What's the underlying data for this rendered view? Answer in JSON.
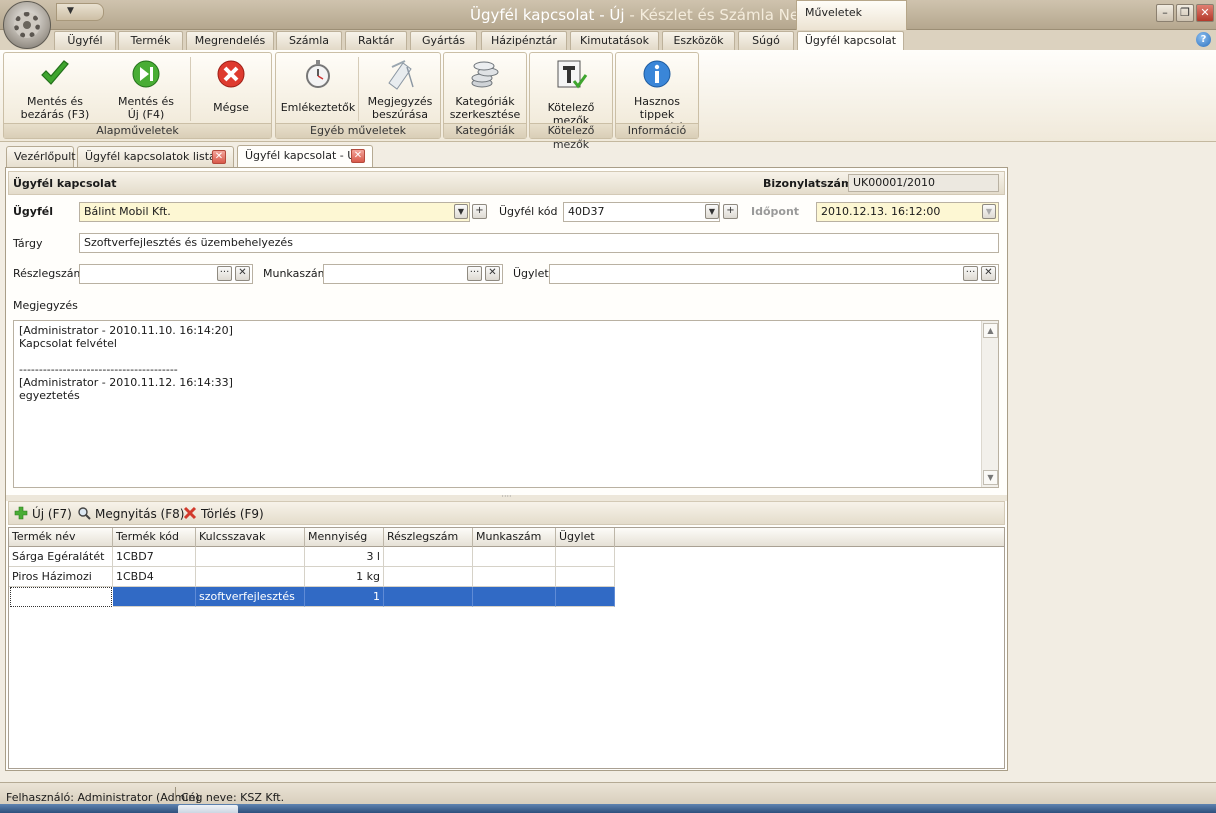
{
  "window": {
    "title": "Ügyfél kapcsolat - Új",
    "title_suffix": " - Készlet és Számla Next Demó",
    "context_tab": "Műveletek"
  },
  "ribbon_tabs": [
    "Ügyfél",
    "Termék",
    "Megrendelés",
    "Számla",
    "Raktár",
    "Gyártás",
    "Házipénztár",
    "Kimutatások",
    "Eszközök",
    "Súgó",
    "Ügyfél kapcsolat"
  ],
  "ribbon_groups": {
    "alap": {
      "label": "Alapműveletek",
      "buttons": [
        {
          "label": "Mentés és\nbezárás (F3)",
          "icon": "checkmark-icon"
        },
        {
          "label": "Mentés és\nÚj (F4)",
          "icon": "save-new-icon"
        },
        {
          "label": "Mégse",
          "icon": "cancel-icon"
        }
      ]
    },
    "egyeb": {
      "label": "Egyéb műveletek",
      "buttons": [
        {
          "label": "Emlékeztetők",
          "icon": "stopwatch-icon"
        },
        {
          "label": "Megjegyzés\nbeszúrása",
          "icon": "note-icon"
        }
      ]
    },
    "kategoriak": {
      "label": "Kategóriák",
      "buttons": [
        {
          "label": "Kategóriák\nszerkesztése",
          "icon": "coins-icon"
        }
      ]
    },
    "kotelezo": {
      "label": "Kötelező mezők",
      "buttons": [
        {
          "label": "Kötelező mezők",
          "icon": "required-fields-icon"
        }
      ]
    },
    "info": {
      "label": "Információ",
      "buttons": [
        {
          "label": "Hasznos tippek\nmegjelenítése",
          "icon": "info-icon"
        }
      ]
    }
  },
  "doc_tabs": [
    "Vezérlőpult",
    "Ügyfél kapcsolatok listája",
    "Ügyfél kapcsolat - Új"
  ],
  "form": {
    "header_title": "Ügyfél kapcsolat",
    "doc_number_label": "Bizonylatszám",
    "doc_number": "UK00001/2010",
    "customer_label": "Ügyfél",
    "customer_value": "Bálint Mobil Kft.",
    "customer_code_label": "Ügyfél kód",
    "customer_code_value": "40D37",
    "time_label": "Időpont",
    "time_value": "2010.12.13. 16:12:00",
    "subject_label": "Tárgy",
    "subject_value": "Szoftverfejlesztés és üzembehelyezés",
    "department_label": "Részlegszám",
    "department_value": "",
    "job_label": "Munkaszám",
    "job_value": "",
    "deal_label": "Ügylet",
    "deal_value": "",
    "note_label": "Megjegyzés",
    "note_lines": [
      "[Administrator - 2010.11.10.  16:14:20]",
      "Kapcsolat felvétel",
      "",
      "----------------------------------------",
      "[Administrator - 2010.11.12.  16:14:33]",
      "egyeztetés"
    ]
  },
  "grid_toolbar": {
    "new_label": "Új (F7)",
    "open_label": "Megnyitás (F8)",
    "delete_label": "Törlés (F9)"
  },
  "grid": {
    "columns": [
      "Termék név",
      "Termék kód",
      "Kulcsszavak",
      "Mennyiség",
      "Részlegszám",
      "Munkaszám",
      "Ügylet"
    ],
    "rows": [
      [
        "Sárga Egéralátét",
        "1CBD7",
        "",
        "3 l",
        "",
        "",
        ""
      ],
      [
        "Piros Házimozi",
        "1CBD4",
        "",
        "1 kg",
        "",
        "",
        ""
      ],
      [
        "",
        "",
        "szoftverfejlesztés",
        "1",
        "",
        "",
        ""
      ]
    ]
  },
  "status": {
    "user": "Felhasználó: Administrator (Admin)",
    "company": "Cég neve: KSZ Kft."
  }
}
